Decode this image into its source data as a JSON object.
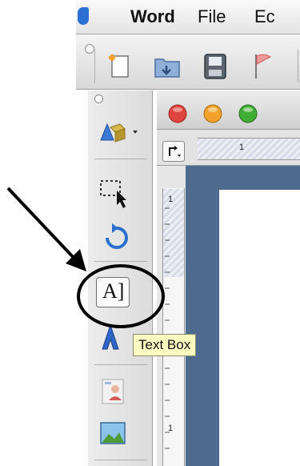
{
  "menubar": {
    "app_name": "Word",
    "items": [
      "File",
      "Ec"
    ]
  },
  "toolbar": {
    "buttons": [
      "new-document-icon",
      "open-folder-icon",
      "save-icon",
      "flag-icon"
    ]
  },
  "toolbox": {
    "tools": [
      "3d-shapes-icon",
      "select-objects-icon",
      "rotate-icon",
      "text-box-icon",
      "wordart-icon",
      "clip-art-icon",
      "picture-icon"
    ],
    "text_box_glyph": "A]"
  },
  "document": {
    "traffic_lights": [
      "#e0443e",
      "#f0a22a",
      "#3fae35"
    ],
    "ruler_h_label": "1",
    "ruler_v_labels": [
      "1",
      "1"
    ]
  },
  "tooltip": {
    "text": "Text Box"
  },
  "colors": {
    "pasteboard": "#4d6a8f",
    "tooltip_bg": "#fdfcc3"
  }
}
